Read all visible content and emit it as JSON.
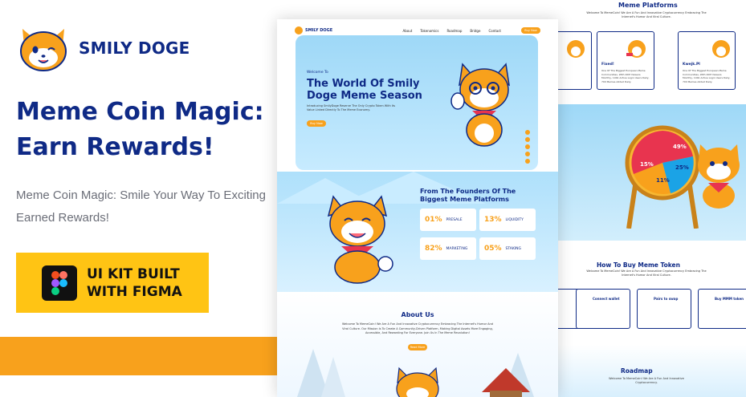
{
  "brand": {
    "name": "SMILY DOGE"
  },
  "promo": {
    "headline": "Meme Coin Magic: Earn Rewards!",
    "subline": "Meme Coin Magic: Smile Your Way To Exciting Earned Rewards!",
    "badge_line1": "UI KIT BUILT",
    "badge_line2": "WITH FIGMA"
  },
  "mock": {
    "nav": {
      "logo": "SMILY DOGE",
      "links": [
        "About",
        "Tokenomics",
        "Roadmap",
        "Bridge",
        "Contact"
      ],
      "cta": "Buy Now"
    },
    "hero": {
      "welcome": "Welcome To",
      "title": "The World Of Smily Doge Meme Season",
      "desc": "Introducing SmilyDoge Reserve The Only Crypto Token With Its Value Linked Directly To The Meme Economy.",
      "cta": "Buy Now"
    },
    "founders": {
      "title": "From The Founders Of The Biggest Meme Platforms",
      "stats": [
        {
          "value": "01%",
          "label": "PRESALE"
        },
        {
          "value": "13%",
          "label": "LIQUIDITY"
        },
        {
          "value": "82%",
          "label": "MARKETING"
        },
        {
          "value": "05%",
          "label": "STAKING"
        }
      ]
    },
    "about": {
      "title": "About Us",
      "text": "Welcome To MemeCoin! We Are A Fun And Innovative Cryptocurrency Embracing The Internet's Humor And Viral Culture. Our Mission Is To Create A Community-Driven Platform, Making Digital Assets More Engaging, Accessible, And Rewarding For Everyone. Join Us In The Meme Revolution!",
      "cta": "Read More"
    }
  },
  "secondary": {
    "platforms_title": "Meme Platforms",
    "platforms_sub": "Welcome To MemeCoin! We Are A Fun And Innovative Cryptocurrency Embracing The Internet's Humor And Viral Culture.",
    "cards": [
      {
        "name": "Fixed!",
        "desc": "One Of The Biggest European Meme Communities, With 20M Viewers Monthly, 100k Active Login Users Daily, 700 Memes Added Daily."
      },
      {
        "name": "Kwejk.Pl",
        "desc": "One Of The Biggest European Meme Communities, With 20M Viewers Monthly, 100k Active Login Users Daily, 700 Memes Added Daily."
      }
    ],
    "wheel": [
      "49%",
      "15%",
      "25%",
      "11%"
    ],
    "howto_title": "How To Buy Meme Token",
    "howto_sub": "Welcome To MemeCoin! We Are A Fun And Innovative Cryptocurrency Embracing The Internet's Humor And Viral Culture.",
    "howto_steps": [
      {
        "name": "Connect wallet"
      },
      {
        "name": "Pairs to swap"
      },
      {
        "name": "Buy MMM token"
      }
    ],
    "roadmap_title": "Roadmap",
    "roadmap_sub": "Welcome To MemeCoin! We Are A Fun And Innovative Cryptocurrency."
  },
  "colors": {
    "navy": "#0f2a86",
    "orange": "#f8a11c",
    "yellow": "#ffc414"
  }
}
